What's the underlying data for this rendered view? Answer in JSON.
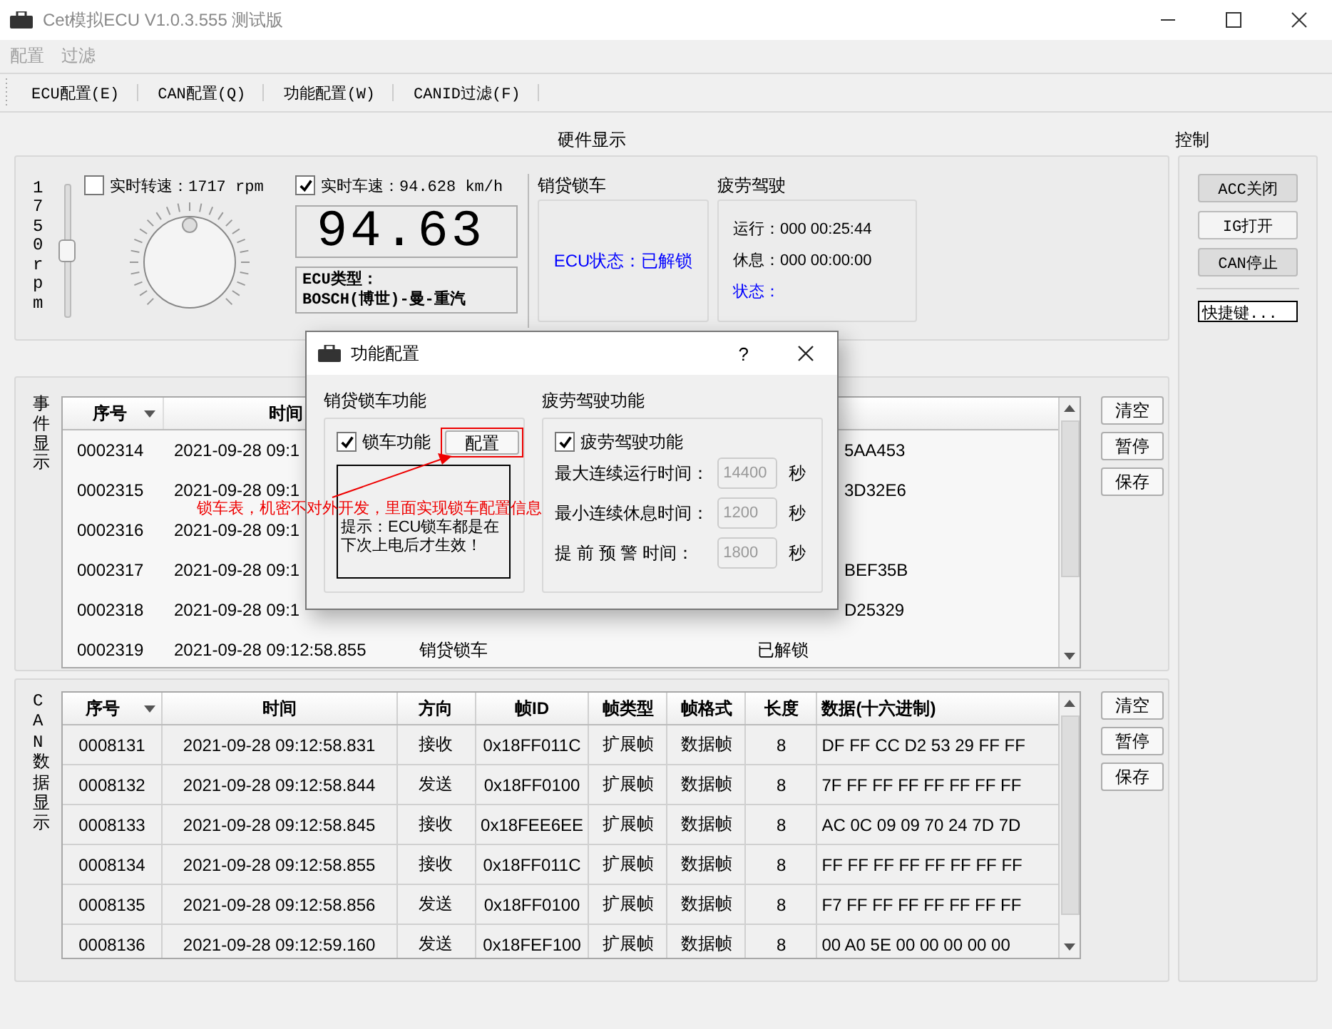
{
  "window": {
    "title": "Cet模拟ECU V1.0.3.555 测试版"
  },
  "menu": [
    {
      "label": "配置",
      "disabled": true
    },
    {
      "label": "过滤",
      "disabled": true
    }
  ],
  "toolbar": [
    "ECU配置(E)",
    "CAN配置(Q)",
    "功能配置(W)",
    "CANID过滤(F)"
  ],
  "hardware": {
    "title": "硬件显示",
    "rpm_slider": {
      "label": "1750rpm",
      "level": 0.5
    },
    "rpm_check": {
      "label": "实时转速：1717 rpm",
      "checked": false
    },
    "speed_check": {
      "label": "实时车速：94.628 km/h",
      "checked": true
    },
    "lcd": "94.63",
    "ecu_type": [
      "ECU类型：",
      "BOSCH(博世)-曼-重汽"
    ],
    "lock": {
      "title": "销贷锁车",
      "status": "ECU状态：已解锁"
    },
    "fatigue": {
      "title": "疲劳驾驶",
      "lines": [
        "运行：000 00:25:44",
        "休息：000 00:00:00"
      ],
      "status": "状态："
    }
  },
  "events": {
    "label": "事件显示",
    "columns": [
      "序号",
      "时间"
    ],
    "rows": [
      {
        "seq": "0002314",
        "time": "2021-09-28 09:1",
        "column_4": "5AA453",
        "clipped": true
      },
      {
        "seq": "0002315",
        "time": "2021-09-28 09:1",
        "column_4": "3D32E6",
        "clipped": true
      },
      {
        "seq": "0002316",
        "time": "2021-09-28 09:1"
      },
      {
        "seq": "0002317",
        "time": "2021-09-28 09:1",
        "column_4": "BEF35B",
        "clipped": true
      },
      {
        "seq": "0002318",
        "time": "2021-09-28 09:1",
        "column_4": "D25329",
        "clipped": true
      },
      {
        "seq": "0002319",
        "time": "2021-09-28 09:12:58.855",
        "column_3": "销贷锁车",
        "column_4": "已解锁",
        "clipped": false
      }
    ],
    "buttons": [
      "清空",
      "暂停",
      "保存"
    ]
  },
  "can": {
    "label": "CAN数据显示",
    "columns": [
      "序号",
      "时间",
      "方向",
      "帧ID",
      "帧类型",
      "帧格式",
      "长度",
      "数据(十六进制)"
    ],
    "rows": [
      [
        "0008131",
        "2021-09-28 09:12:58.831",
        "接收",
        "0x18FF011C",
        "扩展帧",
        "数据帧",
        "8",
        "DF FF CC D2 53 29 FF FF"
      ],
      [
        "0008132",
        "2021-09-28 09:12:58.844",
        "发送",
        "0x18FF0100",
        "扩展帧",
        "数据帧",
        "8",
        "7F FF FF FF FF FF FF FF"
      ],
      [
        "0008133",
        "2021-09-28 09:12:58.845",
        "接收",
        "0x18FEE6EE",
        "扩展帧",
        "数据帧",
        "8",
        "AC 0C 09 09 70 24 7D 7D"
      ],
      [
        "0008134",
        "2021-09-28 09:12:58.855",
        "接收",
        "0x18FF011C",
        "扩展帧",
        "数据帧",
        "8",
        "FF FF FF FF FF FF FF FF"
      ],
      [
        "0008135",
        "2021-09-28 09:12:58.856",
        "发送",
        "0x18FF0100",
        "扩展帧",
        "数据帧",
        "8",
        "F7 FF FF FF FF FF FF FF"
      ],
      [
        "0008136",
        "2021-09-28 09:12:59.160",
        "发送",
        "0x18FEF100",
        "扩展帧",
        "数据帧",
        "8",
        "00 A0 5E 00 00 00 00 00"
      ]
    ],
    "buttons": [
      "清空",
      "暂停",
      "保存"
    ]
  },
  "control": {
    "title": "控制",
    "buttons": [
      {
        "label": "ACC关闭",
        "pressed": true
      },
      {
        "label": "IG打开",
        "pressed": false
      },
      {
        "label": "CAN停止",
        "pressed": true
      }
    ],
    "shortcut": "快捷键..."
  },
  "dialog": {
    "title": "功能配置",
    "help": "?",
    "lock": {
      "title": "销贷锁车功能",
      "check": {
        "label": "锁车功能",
        "checked": true
      },
      "button": "配置",
      "hint": "提示：ECU锁车都是在下次上电后才生效！"
    },
    "fatigue": {
      "title": "疲劳驾驶功能",
      "check": {
        "label": "疲劳驾驶功能",
        "checked": true
      },
      "fields": [
        {
          "label": "最大连续运行时间：",
          "value": "14400",
          "unit": "秒",
          "disabled": true
        },
        {
          "label": "最小连续休息时间：",
          "value": "1200",
          "unit": "秒",
          "disabled": true
        },
        {
          "label": "提 前 预 警 时间：",
          "value": "1800",
          "unit": "秒",
          "disabled": true
        }
      ]
    }
  },
  "annotation": "锁车表，机密不对外开发，里面实现锁车配置信息"
}
